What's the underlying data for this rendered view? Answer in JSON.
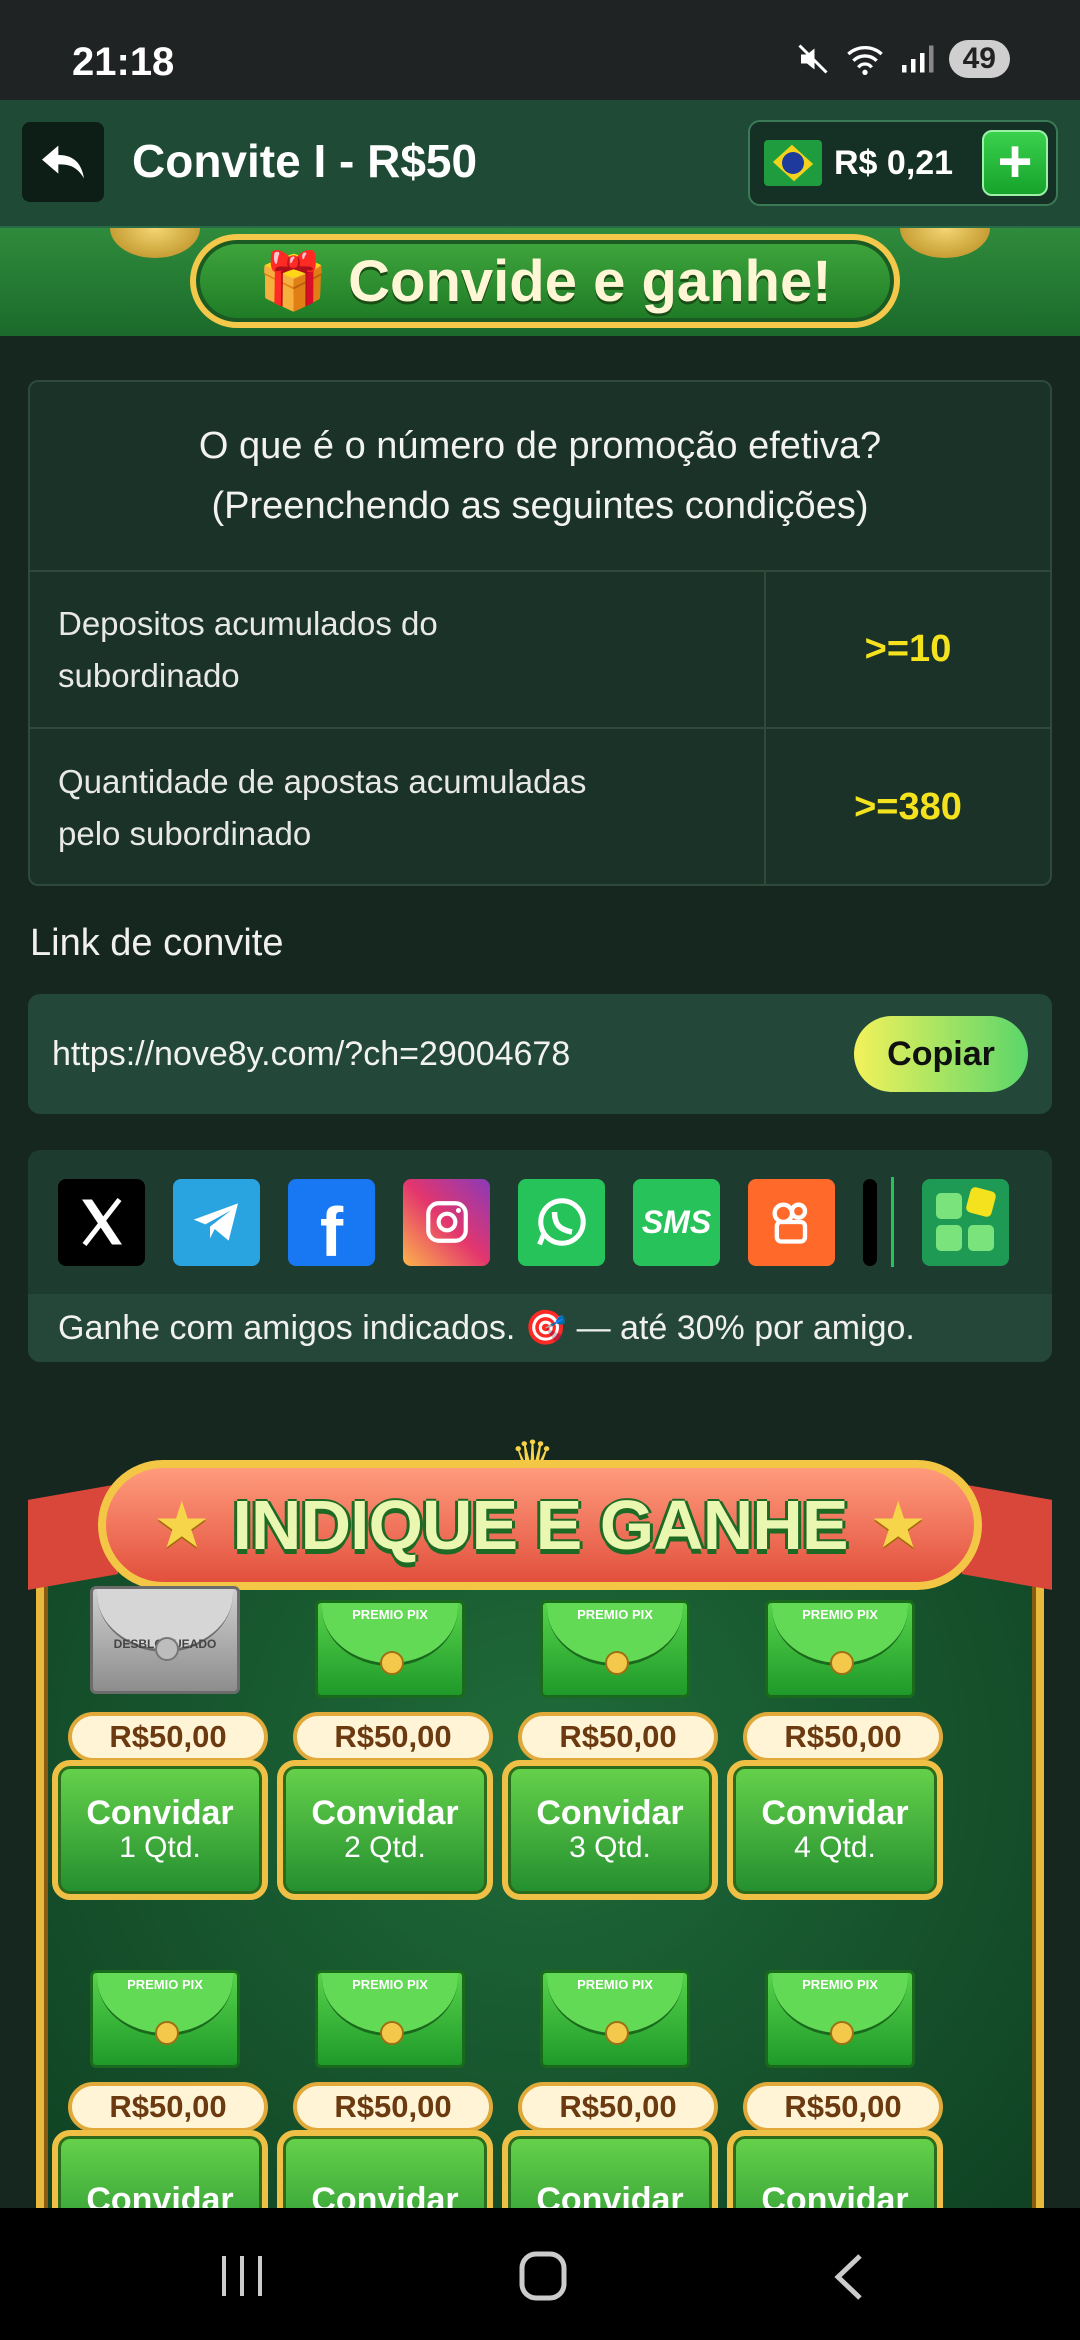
{
  "status": {
    "time": "21:18",
    "battery": "49"
  },
  "header": {
    "title": "Convite I - R$50",
    "balance": "R$ 0,21",
    "plus": "+"
  },
  "banner": {
    "text": "Convide e ganhe!"
  },
  "conditions": {
    "question_line1": "O que é o número de promoção efetiva?",
    "question_line2": "(Preenchendo as seguintes condições)",
    "rows": [
      {
        "label_line1": "Depositos acumulados do",
        "label_line2": "subordinado",
        "value": ">=10"
      },
      {
        "label_line1": "Quantidade de apostas acumuladas",
        "label_line2": "pelo subordinado",
        "value": ">=380"
      }
    ]
  },
  "invite": {
    "label": "Link de convite",
    "url": "https://nove8y.com/?ch=29004678",
    "copy": "Copiar"
  },
  "share": {
    "icons": [
      "x-icon",
      "telegram-icon",
      "facebook-icon",
      "instagram-icon",
      "whatsapp-icon",
      "sms-icon",
      "kwai-icon",
      "tiktok-icon",
      "more-apps-icon"
    ],
    "sms": "SMS",
    "note": "Ganhe com amigos indicados. 🎯 — até 30% por amigo."
  },
  "indique": {
    "title": "INDIQUE E GANHE",
    "unlocked": "DESBLOQUEADO",
    "envelope_text": "PREMIO PIX",
    "cards": [
      {
        "price": "R$50,00",
        "label": "Convidar",
        "qty": "1 Qtd."
      },
      {
        "price": "R$50,00",
        "label": "Convidar",
        "qty": "2 Qtd."
      },
      {
        "price": "R$50,00",
        "label": "Convidar",
        "qty": "3 Qtd."
      },
      {
        "price": "R$50,00",
        "label": "Convidar",
        "qty": "4 Qtd."
      },
      {
        "price": "R$50,00",
        "label": "Convidar",
        "qty": ""
      },
      {
        "price": "R$50,00",
        "label": "Convidar",
        "qty": ""
      },
      {
        "price": "R$50,00",
        "label": "Convidar",
        "qty": ""
      },
      {
        "price": "R$50,00",
        "label": "Convidar",
        "qty": ""
      }
    ]
  }
}
